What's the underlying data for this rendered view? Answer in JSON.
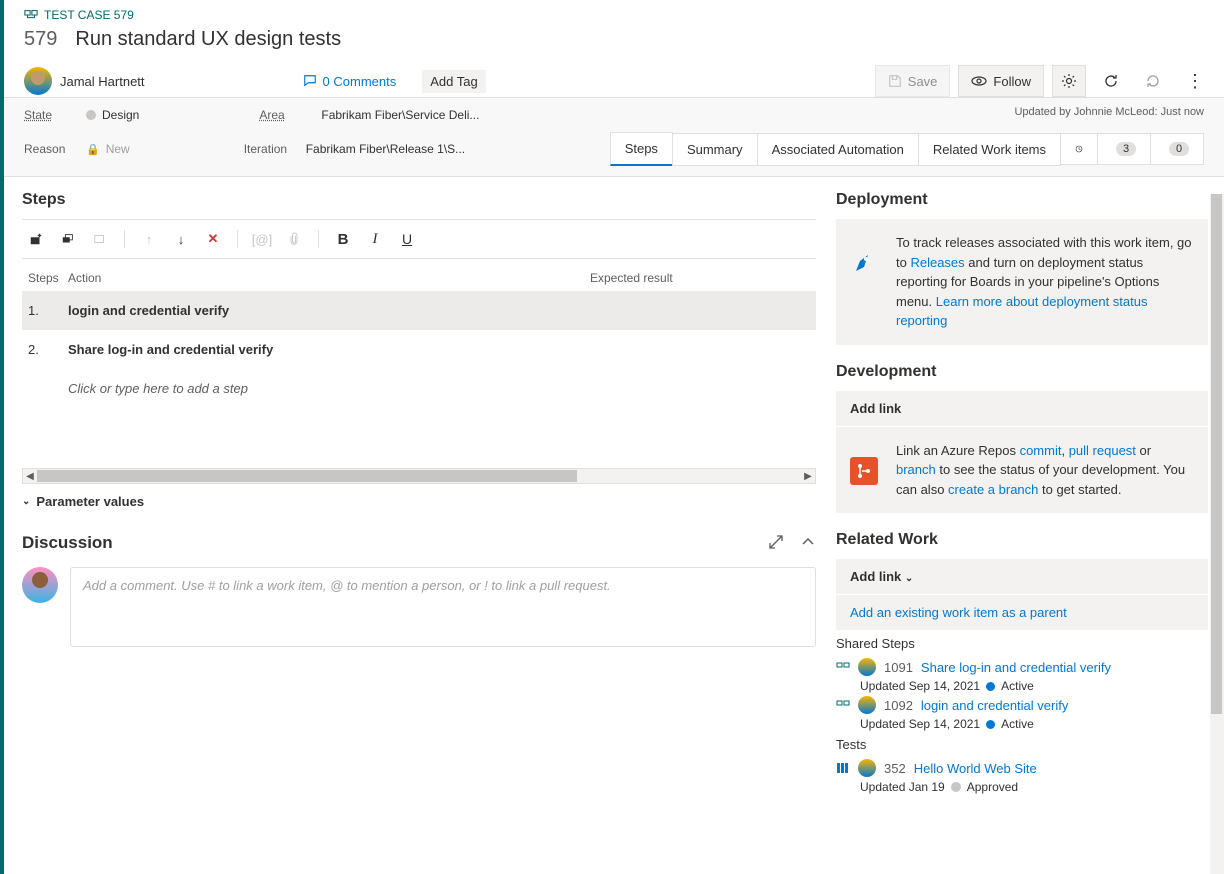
{
  "header": {
    "type_label": "TEST CASE 579",
    "id": "579",
    "title": "Run standard UX design tests",
    "assignee": "Jamal Hartnett",
    "comments_count": "0 Comments",
    "add_tag": "Add Tag",
    "save": "Save",
    "follow": "Follow",
    "updated_by": "Updated by Johnnie McLeod: Just now"
  },
  "fields": {
    "state_label": "State",
    "state_value": "Design",
    "reason_label": "Reason",
    "reason_value": "New",
    "area_label": "Area",
    "area_value": "Fabrikam Fiber\\Service Deli...",
    "iteration_label": "Iteration",
    "iteration_value": "Fabrikam Fiber\\Release 1\\S..."
  },
  "tabs": {
    "steps": "Steps",
    "summary": "Summary",
    "automation": "Associated Automation",
    "related": "Related Work items",
    "links_count": "3",
    "attachments_count": "0"
  },
  "steps": {
    "title": "Steps",
    "col_steps": "Steps",
    "col_action": "Action",
    "col_expected": "Expected result",
    "rows": [
      {
        "num": "1.",
        "action": "login and credential verify"
      },
      {
        "num": "2.",
        "action": "Share log-in and credential verify"
      }
    ],
    "placeholder": "Click or type here to add a step",
    "param_values": "Parameter values"
  },
  "discussion": {
    "title": "Discussion",
    "placeholder": "Add a comment. Use # to link a work item, @ to mention a person, or ! to link a pull request."
  },
  "side": {
    "deployment": {
      "title": "Deployment",
      "text1": "To track releases associated with this work item, go to ",
      "link1": "Releases",
      "text2": " and turn on deployment status reporting for Boards in your pipeline's Options menu. ",
      "link2": "Learn more about deployment status reporting"
    },
    "development": {
      "title": "Development",
      "addlink": "Add link",
      "text1": "Link an Azure Repos ",
      "link_commit": "commit",
      "link_pr": "pull request",
      "or": " or ",
      "link_branch": "branch",
      "text2": " to see the status of your development. You can also ",
      "link_create": "create a branch",
      "text3": " to get started."
    },
    "related": {
      "title": "Related Work",
      "addlink": "Add link",
      "add_existing": "Add an existing work item as a parent",
      "shared_steps": "Shared Steps",
      "tests": "Tests",
      "items": [
        {
          "id": "1091",
          "title": "Share log-in and credential verify",
          "meta": "Updated Sep 14, 2021",
          "state": "Active",
          "stateColor": "blue"
        },
        {
          "id": "1092",
          "title": "login and credential verify",
          "meta": "Updated Sep 14, 2021",
          "state": "Active",
          "stateColor": "blue"
        }
      ],
      "test_items": [
        {
          "id": "352",
          "title": "Hello World Web Site",
          "meta": "Updated Jan 19",
          "state": "Approved",
          "stateColor": "gray"
        }
      ]
    }
  }
}
